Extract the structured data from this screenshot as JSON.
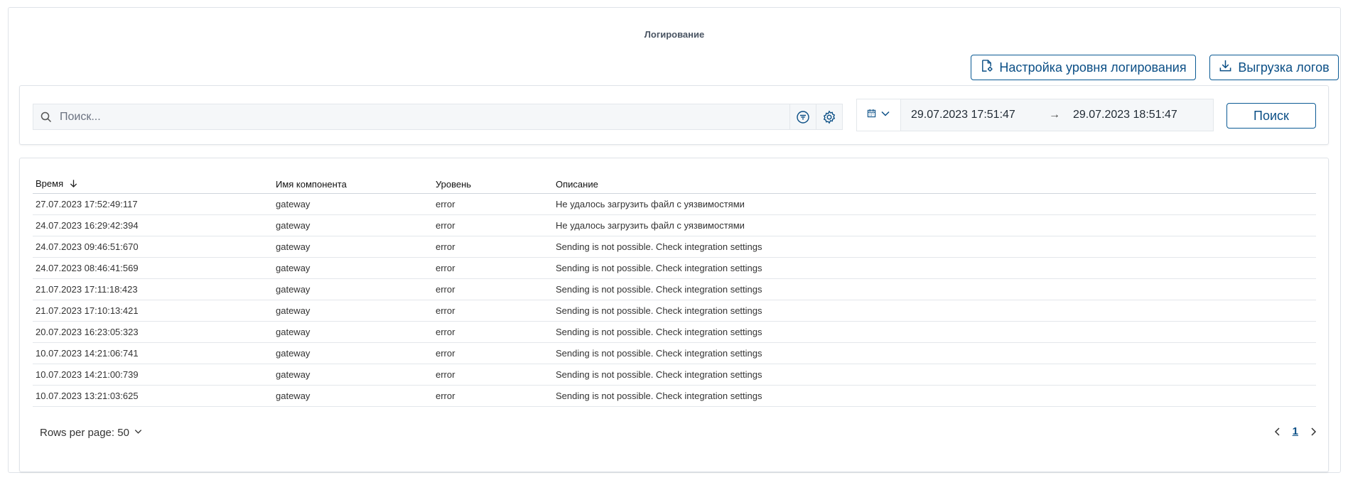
{
  "header": {
    "title": "Логирование",
    "level_button_label": "Настройка уровня логирования",
    "export_button_label": "Выгрузка логов"
  },
  "filters": {
    "search_placeholder": "Поиск...",
    "date_from": "29.07.2023 17:51:47",
    "date_arrow": "→",
    "date_to": "29.07.2023 18:51:47",
    "search_button_label": "Поиск"
  },
  "table": {
    "columns": [
      "Время",
      "Имя компонента",
      "Уровень",
      "Описание"
    ],
    "rows": [
      [
        "27.07.2023 17:52:49:117",
        "gateway",
        "error",
        "Не удалось загрузить файл с уязвимостями"
      ],
      [
        "24.07.2023 16:29:42:394",
        "gateway",
        "error",
        "Не удалось загрузить файл с уязвимостями"
      ],
      [
        "24.07.2023 09:46:51:670",
        "gateway",
        "error",
        "Sending is not possible. Check integration settings"
      ],
      [
        "24.07.2023 08:46:41:569",
        "gateway",
        "error",
        "Sending is not possible. Check integration settings"
      ],
      [
        "21.07.2023 17:11:18:423",
        "gateway",
        "error",
        "Sending is not possible. Check integration settings"
      ],
      [
        "21.07.2023 17:10:13:421",
        "gateway",
        "error",
        "Sending is not possible. Check integration settings"
      ],
      [
        "20.07.2023 16:23:05:323",
        "gateway",
        "error",
        "Sending is not possible. Check integration settings"
      ],
      [
        "10.07.2023 14:21:06:741",
        "gateway",
        "error",
        "Sending is not possible. Check integration settings"
      ],
      [
        "10.07.2023 14:21:00:739",
        "gateway",
        "error",
        "Sending is not possible. Check integration settings"
      ],
      [
        "10.07.2023 13:21:03:625",
        "gateway",
        "error",
        "Sending is not possible. Check integration settings"
      ]
    ]
  },
  "pagination": {
    "rows_per_page_label": "Rows per page: 50",
    "current_page": "1"
  },
  "colors": {
    "accent": "#0b4f86",
    "border": "#dfe3e8"
  },
  "icons": {
    "level_button": "settings-file-icon",
    "export_button": "download-icon",
    "search": "search-icon",
    "filter": "filter-icon",
    "settings": "gear-icon",
    "calendar": "calendar-icon",
    "sort": "arrow-down-icon"
  }
}
